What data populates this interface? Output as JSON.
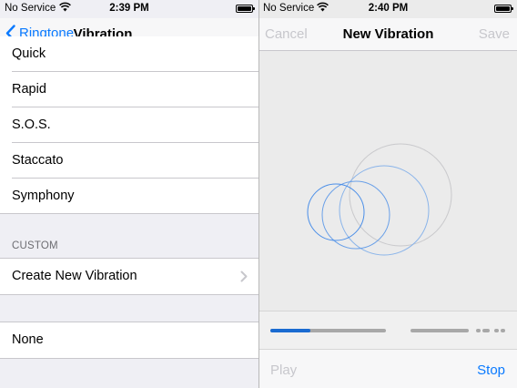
{
  "left": {
    "status": {
      "carrier": "No Service",
      "time": "2:39 PM"
    },
    "nav": {
      "back_label": "Ringtone",
      "title": "Vibration"
    },
    "items": [
      "Quick",
      "Rapid",
      "S.O.S.",
      "Staccato",
      "Symphony"
    ],
    "custom": {
      "header": "CUSTOM",
      "create_label": "Create New Vibration"
    },
    "none_label": "None"
  },
  "right": {
    "status": {
      "carrier": "No Service",
      "time": "2:40 PM"
    },
    "nav": {
      "cancel_label": "Cancel",
      "title": "New Vibration",
      "save_label": "Save"
    },
    "toolbar": {
      "play_label": "Play",
      "stop_label": "Stop"
    },
    "progress": 0.35
  },
  "colors": {
    "accent": "#0a7aff",
    "disabled": "#c7c7cc",
    "ring_light": "#c9c9cc"
  },
  "icons": [
    "wifi-icon",
    "battery-icon",
    "back-chevron-icon",
    "chevron-right-icon"
  ]
}
